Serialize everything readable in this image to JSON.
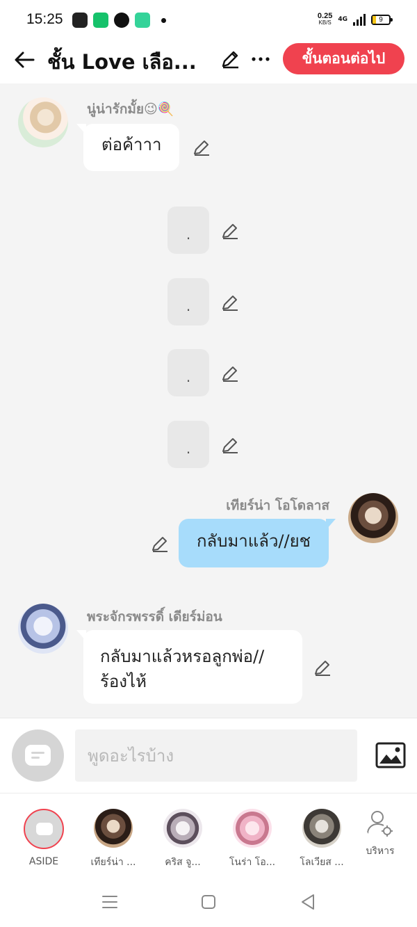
{
  "status_bar": {
    "time": "15:25",
    "net_speed": "0.25",
    "net_unit": "KB/S",
    "network_type": "4G",
    "battery": "9"
  },
  "header": {
    "title": "ชั้น Love เลือ...",
    "next_button": "ขั้นตอนต่อไป"
  },
  "messages": [
    {
      "sender": "นู่น่ารักมั้ย😉🍭",
      "text": "ต่อค้าาา",
      "side": "left"
    },
    {
      "text": ".",
      "side": "center"
    },
    {
      "text": ".",
      "side": "center"
    },
    {
      "text": ".",
      "side": "center"
    },
    {
      "text": ".",
      "side": "center"
    },
    {
      "sender": "เทียร์น่า โอโดลาส",
      "text": "กลับมาแล้ว//ยช",
      "side": "right"
    },
    {
      "sender": "พระจักรพรรดิ์ เดียร์ม่อน",
      "text_line1": "กลับมาแล้วหรอลูกพ่อ//",
      "text_line2": "ร้องไห้",
      "side": "left"
    }
  ],
  "input": {
    "placeholder": "พูดอะไรบ้าง"
  },
  "characters": [
    {
      "label": "ASIDE"
    },
    {
      "label": "เทียร์น่า ..."
    },
    {
      "label": "คริส จู..."
    },
    {
      "label": "โนร่า โอ..."
    },
    {
      "label": "โลเวียส ..."
    },
    {
      "label": "บริหาร"
    }
  ],
  "colors": {
    "accent": "#f0424f",
    "right_bubble": "#a7dcfb",
    "chat_bg": "#f4f4f4"
  },
  "icons": [
    "back-arrow-icon",
    "pencil-icon",
    "more-icon",
    "image-icon",
    "chat-bubble-icon",
    "person-gear-icon",
    "menu-icon",
    "home-square-icon",
    "back-triangle-icon"
  ]
}
